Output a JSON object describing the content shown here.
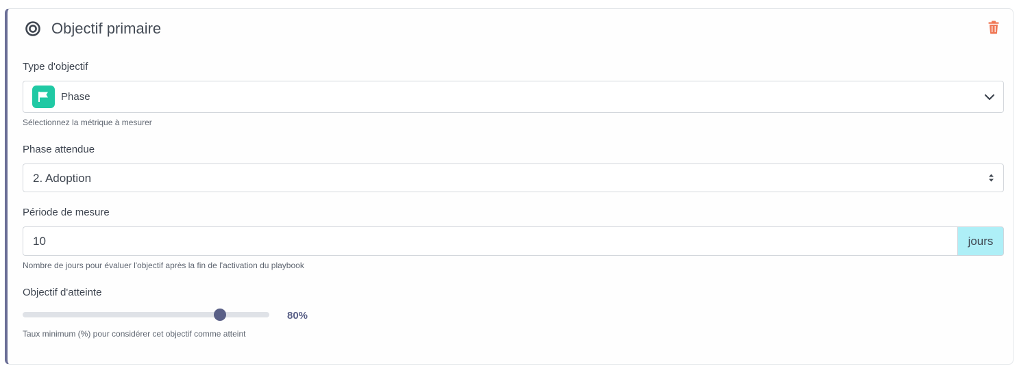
{
  "card": {
    "title": "Objectif primaire",
    "icon": "target-icon",
    "delete_icon": "trash-icon",
    "colors": {
      "accent": "#6a6e96",
      "delete": "#f07856",
      "badge": "#20c9a4",
      "addon": "#aeeff7"
    }
  },
  "objective_type": {
    "label": "Type d'objectif",
    "icon": "flag-icon",
    "value": "Phase",
    "help": "Sélectionnez la métrique à mesurer"
  },
  "expected_phase": {
    "label": "Phase attendue",
    "value": "2. Adoption"
  },
  "measure_period": {
    "label": "Période de mesure",
    "value": "10",
    "unit": "jours",
    "help": "Nombre de jours pour évaluer l'objectif après la fin de l'activation du playbook"
  },
  "target_rate": {
    "label": "Objectif d'atteinte",
    "value_percent": 80,
    "display": "80%",
    "help": "Taux minimum (%) pour considérer cet objectif comme atteint"
  }
}
